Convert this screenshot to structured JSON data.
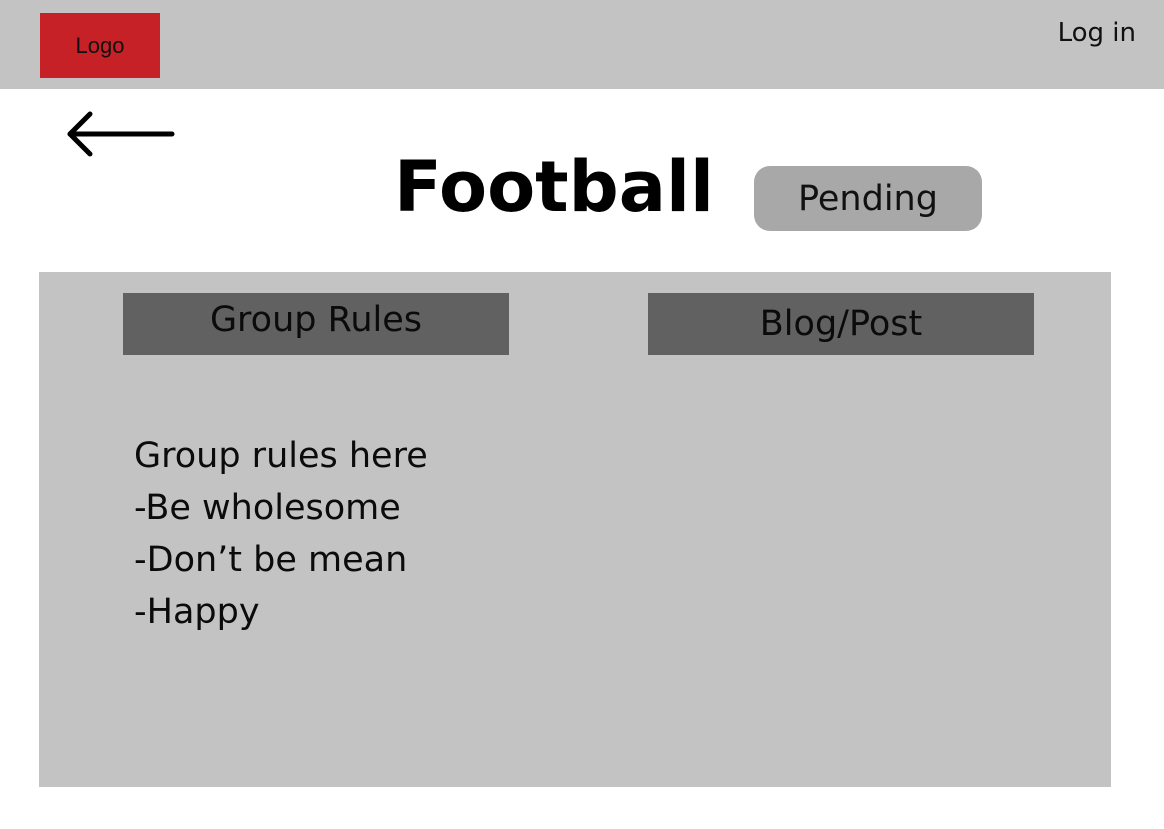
{
  "header": {
    "logo_label": "Logo",
    "login_label": "Log in"
  },
  "nav": {
    "back_icon": "arrow-left-icon"
  },
  "group": {
    "title": "Football",
    "status": "Pending"
  },
  "tabs": [
    {
      "label": "Group Rules"
    },
    {
      "label": "Blog/Post"
    }
  ],
  "rules": {
    "heading": "Group rules here",
    "items": [
      "-Be wholesome",
      "-Don’t be mean",
      "-Happy"
    ]
  },
  "colors": {
    "topbar": "#c3c3c3",
    "logo": "#c62127",
    "panel": "#c3c3c3",
    "tab": "#616161",
    "badge": "#a8a8a8"
  }
}
